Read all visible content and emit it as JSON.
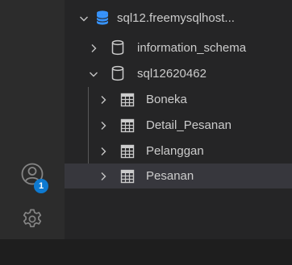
{
  "accounts": {
    "icon": "account-icon",
    "badge_count": "1",
    "badge_color": "#0e7ad1"
  },
  "manage": {
    "icon": "gear-icon"
  },
  "tree": {
    "connection": {
      "label": "sql12.freemysqlhost...",
      "icon": "database-stack-icon",
      "icon_color": "#3794ff",
      "expanded": true
    },
    "databases": [
      {
        "label": "information_schema",
        "icon": "database-icon",
        "expanded": false
      },
      {
        "label": "sql12620462",
        "icon": "database-icon",
        "expanded": true
      }
    ],
    "tables": [
      {
        "label": "Boneka",
        "icon": "table-icon"
      },
      {
        "label": "Detail_Pesanan",
        "icon": "table-icon"
      },
      {
        "label": "Pelanggan",
        "icon": "table-icon"
      },
      {
        "label": "Pesanan",
        "icon": "table-icon",
        "selected": true
      }
    ]
  }
}
